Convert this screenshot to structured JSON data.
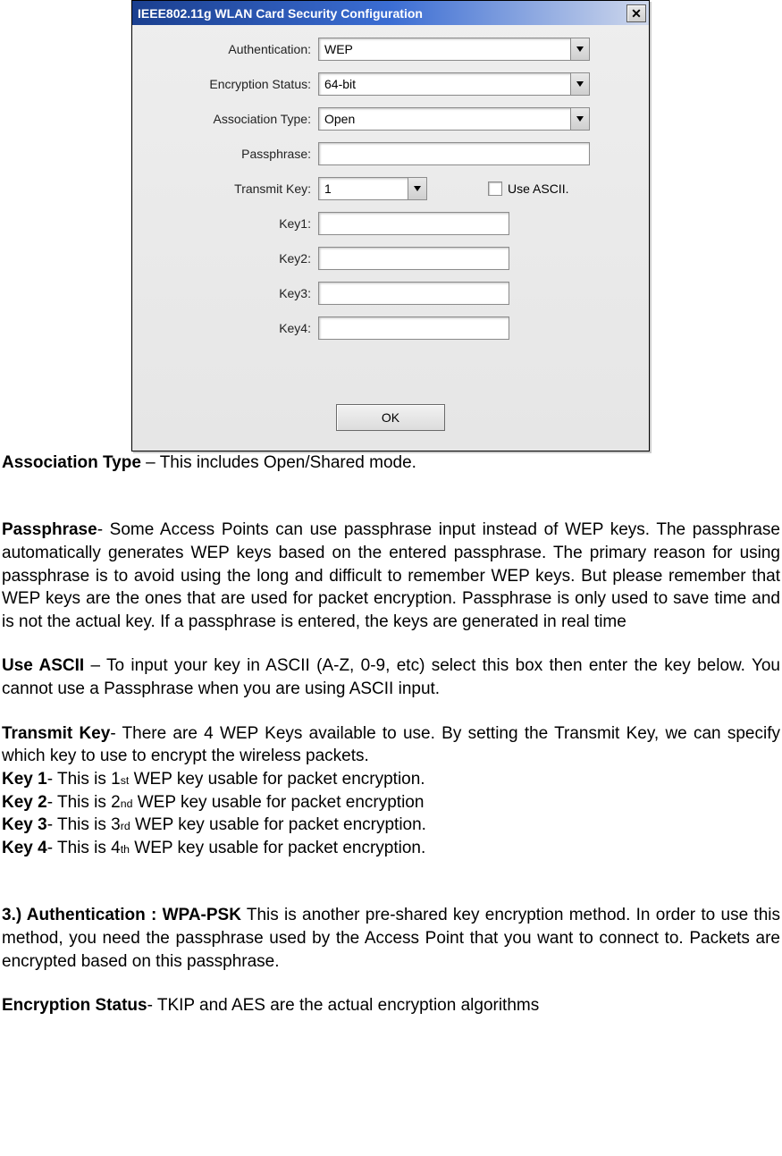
{
  "dialog": {
    "title": "IEEE802.11g WLAN Card Security Configuration",
    "close_glyph": "✕",
    "labels": {
      "authentication": "Authentication:",
      "encryption_status": "Encryption Status:",
      "association_type": "Association Type:",
      "passphrase": "Passphrase:",
      "transmit_key": "Transmit Key:",
      "use_ascii": "Use ASCII.",
      "key1": "Key1:",
      "key2": "Key2:",
      "key3": "Key3:",
      "key4": "Key4:"
    },
    "values": {
      "authentication": "WEP",
      "encryption_status": "64-bit",
      "association_type": "Open",
      "passphrase": "",
      "transmit_key": "1",
      "use_ascii_checked": false,
      "key1": "",
      "key2": "",
      "key3": "",
      "key4": ""
    },
    "ok_label": "OK"
  },
  "doc": {
    "p1_bold": "Association Type",
    "p1_rest": " – This includes Open/Shared mode.",
    "p2_bold": "Passphrase",
    "p2_rest": "- Some Access Points can use passphrase input instead of WEP keys. The passphrase automatically generates WEP keys based on the entered passphrase. The primary reason for using passphrase is to avoid using the long and difficult to remember WEP keys. But please remember that WEP keys are the ones that are used for packet encryption. Passphrase is only used to save time and is not the actual key. If a passphrase is entered, the keys are generated in real time",
    "p3_bold": "Use ASCII",
    "p3_rest": " – To input your key in ASCII (A-Z, 0-9, etc) select this box then enter the key below. You cannot use a Passphrase when you are using ASCII input.",
    "p4_bold": "Transmit Key",
    "p4_rest": "- There are 4 WEP Keys available to use. By setting the Transmit Key, we can specify which key to use to encrypt the wireless packets.",
    "k1_bold": "Key 1",
    "k1_a": "- This is 1",
    "k1_ord": "st",
    "k1_b": " WEP key usable for packet encryption.",
    "k2_bold": "Key 2",
    "k2_a": "- This is 2",
    "k2_ord": "nd",
    "k2_b": " WEP key usable for packet encryption",
    "k3_bold": "Key 3",
    "k3_a": "- This is 3",
    "k3_ord": "rd",
    "k3_b": " WEP key usable for packet encryption.",
    "k4_bold": "Key 4",
    "k4_a": "- This is 4",
    "k4_ord": "th",
    "k4_b": " WEP key usable for packet encryption.",
    "p5_bold": "3.) Authentication : WPA-PSK",
    "p5_rest": " This is another pre-shared key encryption method. In order to use this method, you need the passphrase used by the Access Point that you want to connect to. Packets are encrypted based on this passphrase.",
    "p6_bold": "Encryption Status",
    "p6_rest": "- TKIP and AES are the actual encryption algorithms"
  }
}
